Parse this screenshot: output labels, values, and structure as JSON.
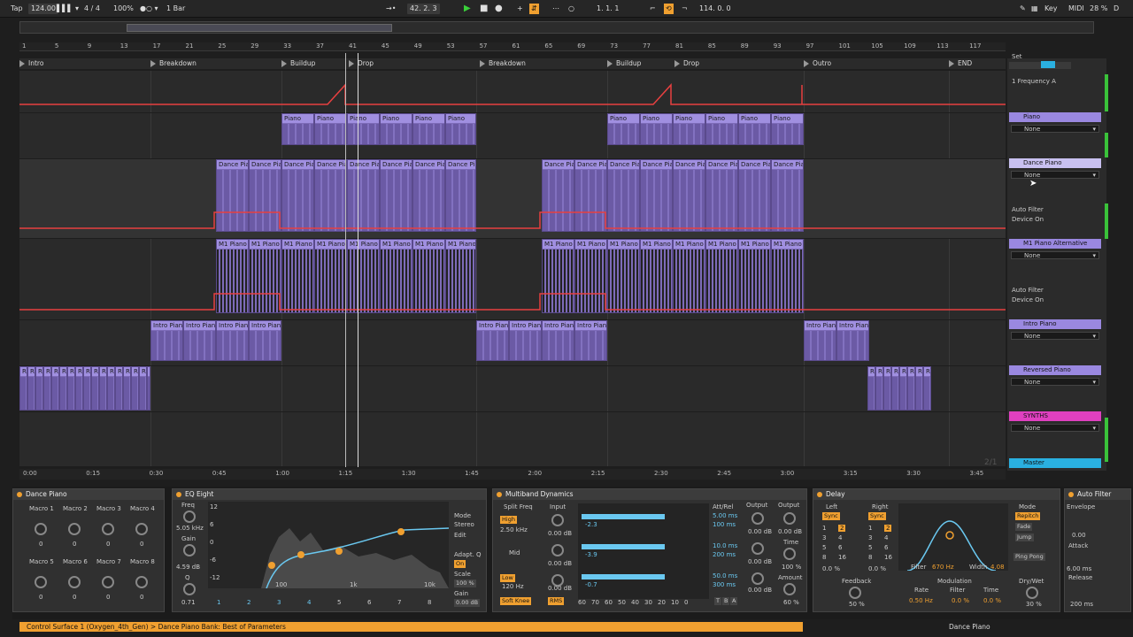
{
  "transport": {
    "tap": "Tap",
    "tempo": "124.00",
    "sig": "4 / 4",
    "zoom": "100%",
    "quant": "1 Bar",
    "position": "42.  2.  3",
    "loop_start": "1.  1.  1",
    "loop_len": "114.  0.  0",
    "key": "Key",
    "midi": "MIDI",
    "cpu": "28 %",
    "d": "D"
  },
  "ruler_bars": [
    "1",
    "5",
    "9",
    "13",
    "17",
    "21",
    "25",
    "29",
    "33",
    "37",
    "41",
    "45",
    "49",
    "53",
    "57",
    "61",
    "65",
    "69",
    "73",
    "77",
    "81",
    "85",
    "89",
    "93",
    "97",
    "101",
    "105",
    "109",
    "113",
    "117"
  ],
  "locators": [
    {
      "label": "Intro"
    },
    {
      "label": "Breakdown"
    },
    {
      "label": "Buildup"
    },
    {
      "label": "Drop"
    },
    {
      "label": "Breakdown"
    },
    {
      "label": "Buildup"
    },
    {
      "label": "Drop"
    },
    {
      "label": "Outro"
    },
    {
      "label": "END"
    }
  ],
  "time_marks": [
    "0:00",
    "0:15",
    "0:30",
    "0:45",
    "1:00",
    "1:15",
    "1:30",
    "1:45",
    "2:00",
    "2:15",
    "2:30",
    "2:45",
    "3:00",
    "3:15",
    "3:30",
    "3:45"
  ],
  "clip_names": {
    "piano": "Piano",
    "dance": "Dance Pia",
    "m1": "M1 Piano",
    "intro": "Intro Pian",
    "rev": "Re"
  },
  "page_counter": "2/1",
  "mixer": {
    "set": "Set",
    "freq_label": "1 Frequency A",
    "tracks": [
      {
        "name": "Piano",
        "sel": "None"
      },
      {
        "name": "Dance Piano",
        "sel": "None",
        "auto1": "Auto Filter",
        "auto2": "Device On"
      },
      {
        "name": "M1 Piano Alternative",
        "sel": "None",
        "auto1": "Auto Filter",
        "auto2": "Device On"
      },
      {
        "name": "Intro Piano",
        "sel": "None"
      },
      {
        "name": "Reversed Piano",
        "sel": "None"
      },
      {
        "name": "SYNTHS",
        "sel": "None"
      },
      {
        "name": "Master"
      }
    ]
  },
  "devices": {
    "rack": {
      "title": "Dance Piano",
      "macros": [
        "Macro 1",
        "Macro 2",
        "Macro 3",
        "Macro 4",
        "Macro 5",
        "Macro 6",
        "Macro 7",
        "Macro 8"
      ],
      "values": [
        "0",
        "0",
        "0",
        "0",
        "0",
        "0",
        "0",
        "0"
      ]
    },
    "eq": {
      "title": "EQ Eight",
      "freq_label": "Freq",
      "freq": "5.05 kHz",
      "gain_label": "Gain",
      "gain": "4.59 dB",
      "q_label": "Q",
      "q": "0.71",
      "mode": "Mode",
      "stereo": "Stereo",
      "edit": "Edit",
      "adapt": "Adapt. Q",
      "on": "On",
      "scale": "Scale",
      "scale_val": "100 %",
      "gain2": "Gain",
      "gain2_val": "0.00 dB",
      "y_ticks": [
        "12",
        "6",
        "0",
        "-6",
        "-12"
      ],
      "x_ticks": [
        "100",
        "1k",
        "10k"
      ],
      "bands": [
        "1",
        "2",
        "3",
        "4",
        "5",
        "6",
        "7",
        "8"
      ]
    },
    "mbd": {
      "title": "Multiband Dynamics",
      "split": "Split Freq",
      "input": "Input",
      "high": "High",
      "high_freq": "2.50 kHz",
      "mid": "Mid",
      "low": "Low",
      "low_freq": "120 Hz",
      "in_vals": [
        "0.00 dB",
        "0.00 dB",
        "0.00 dB"
      ],
      "meters": [
        "-2.3",
        "-3.9",
        "-0.7"
      ],
      "attrel": "Att/Rel",
      "att_vals": [
        "5.00 ms",
        "100 ms",
        "10.0 ms",
        "200 ms",
        "50.0 ms",
        "300 ms"
      ],
      "output": "Output",
      "out_vals": [
        "0.00 dB",
        "0.00 dB",
        "0.00 dB"
      ],
      "output2": "Output",
      "out2": "0.00 dB",
      "time": "Time",
      "time_val": "100 %",
      "amount": "Amount",
      "amount_val": "60 %",
      "soft": "Soft Knee",
      "rms": "RMS",
      "scale": [
        "60",
        "70",
        "60",
        "50",
        "40",
        "30",
        "20",
        "10",
        "0"
      ],
      "tba": [
        "T",
        "B",
        "A"
      ]
    },
    "delay": {
      "title": "Delay",
      "left": "Left",
      "right": "Right",
      "sync": "Sync",
      "grid": [
        "1",
        "2",
        "3",
        "4",
        "5",
        "6",
        "8",
        "16"
      ],
      "left_pct": "0.0 %",
      "right_pct": "0.0 %",
      "filter": "Filter",
      "filter_val": "670 Hz",
      "width": "Width",
      "width_val": "4.08",
      "mode": "Mode",
      "repitch": "Repitch",
      "fade": "Fade",
      "jump": "Jump",
      "pingpong": "Ping Pong",
      "feedback": "Feedback",
      "feedback_val": "50 %",
      "modulation": "Modulation",
      "rate": "Rate",
      "rate_val": "0.50 Hz",
      "mfilter": "Filter",
      "mfilter_val": "0.0 %",
      "mtime": "Time",
      "mtime_val": "0.0 %",
      "drywet": "Dry/Wet",
      "drywet_val": "30 %"
    },
    "autofilter": {
      "title": "Auto Filter",
      "envelope": "Envelope",
      "env_val": "0.00",
      "attack": "Attack",
      "attack_val": "6.00 ms",
      "release": "Release",
      "release_val": "200 ms"
    }
  },
  "status": {
    "text": "Control Surface 1 (Oxygen_4th_Gen) > Dance Piano Bank: Best of Parameters",
    "right": "Dance Piano"
  },
  "colors": {
    "clip": "#7d6bb8",
    "clip_header": "#a08fe0",
    "accent": "#f0a030",
    "automation": "#e84040",
    "synths": "#e040c0",
    "master": "#2ab0e0"
  }
}
